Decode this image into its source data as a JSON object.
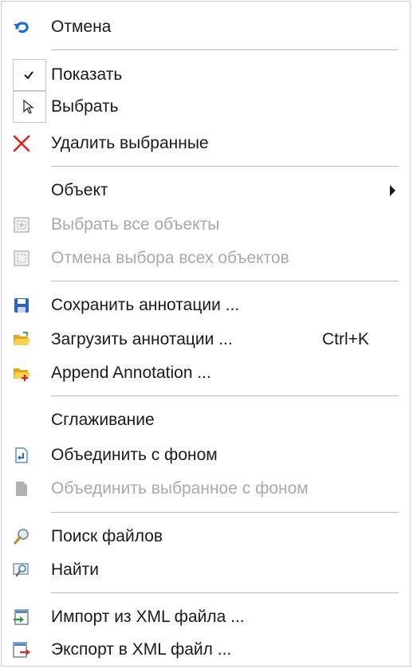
{
  "menu": {
    "items": [
      {
        "label": "Отмена",
        "icon": "undo-icon"
      },
      {
        "label": "Показать",
        "icon": "checkmark-icon",
        "checked": true
      },
      {
        "label": "Выбрать",
        "icon": "pointer-arrow-icon"
      },
      {
        "label": "Удалить выбранные",
        "icon": "delete-x-icon"
      },
      {
        "label": "Объект",
        "submenu": true
      },
      {
        "label": "Выбрать все объекты",
        "icon": "select-all-icon",
        "disabled": true
      },
      {
        "label": "Отмена выбора всех объектов",
        "icon": "deselect-all-icon",
        "disabled": true
      },
      {
        "label": "Сохранить аннотации ...",
        "icon": "save-disk-icon"
      },
      {
        "label": "Загрузить аннотации ...",
        "icon": "open-folder-icon",
        "shortcut": "Ctrl+K"
      },
      {
        "label": "Append Annotation ...",
        "icon": "folder-add-icon"
      },
      {
        "label": "Сглаживание"
      },
      {
        "label": "Объединить с фоном",
        "icon": "merge-document-icon"
      },
      {
        "label": "Объединить выбранное с фоном",
        "icon": "merge-selection-icon",
        "disabled": true
      },
      {
        "label": "Поиск файлов",
        "icon": "magnifier-icon"
      },
      {
        "label": "Найти",
        "icon": "find-window-icon"
      },
      {
        "label": "Импорт из XML файла ...",
        "icon": "import-xml-icon"
      },
      {
        "label": "Экспорт в XML файл ...",
        "icon": "export-xml-icon"
      }
    ]
  },
  "colors": {
    "text": "#1a1a1a",
    "disabled_text": "#a9a9a9",
    "separator": "#b9b9b9",
    "accent_blue": "#1f6fd1",
    "delete_red": "#e02020",
    "folder_yellow": "#f2c230"
  }
}
